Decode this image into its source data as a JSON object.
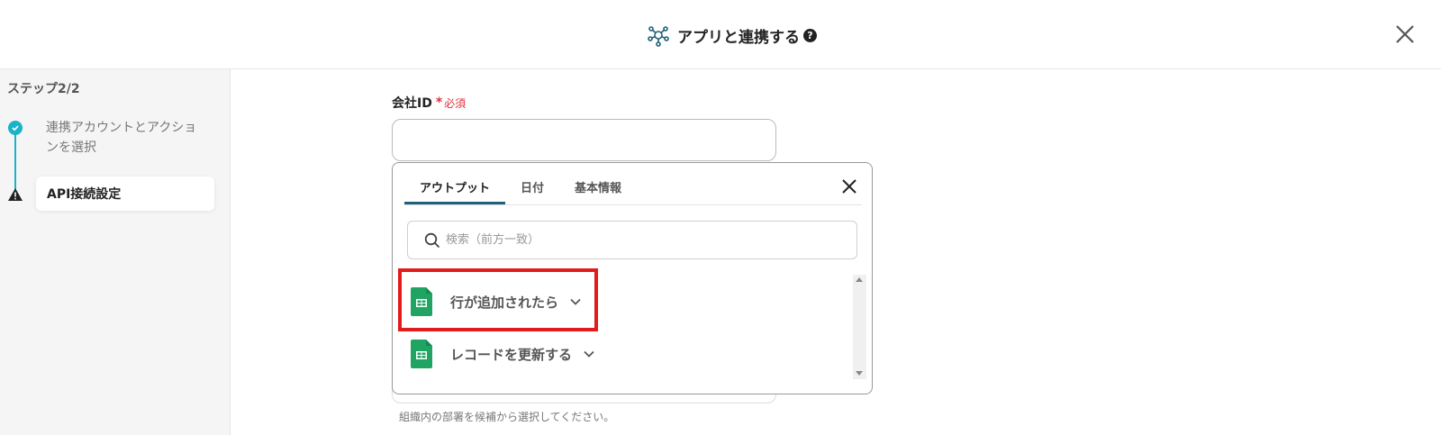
{
  "header": {
    "title": "アプリと連携する",
    "help_icon": "?",
    "icons": [
      "hub-icon",
      "help-icon",
      "close-icon"
    ]
  },
  "sidebar": {
    "heading": "ステップ2/2",
    "steps": [
      {
        "label": "連携アカウントとアクションを選択",
        "status": "completed",
        "icon": "check-icon"
      },
      {
        "label": "API接続設定",
        "status": "warning",
        "icon": "warning-icon"
      }
    ]
  },
  "form": {
    "field_label": "会社ID",
    "required_mark": "*",
    "required_text": "必須",
    "company_id_value": "",
    "helper_text": "組織内の部署を候補から選択してください。"
  },
  "dropdown": {
    "tabs": [
      {
        "label": "アウトプット",
        "active": true
      },
      {
        "label": "日付",
        "active": false
      },
      {
        "label": "基本情報",
        "active": false
      }
    ],
    "search_placeholder": "検索（前方一致）",
    "items": [
      {
        "label": "行が追加されたら",
        "icon": "google-sheets-icon",
        "highlighted": true
      },
      {
        "label": "レコードを更新する",
        "icon": "google-sheets-icon",
        "highlighted": false
      }
    ]
  },
  "colors": {
    "accent": "#1bb3c9",
    "required": "#e0313c",
    "highlight": "#e21c1c",
    "sheets_green": "#1fa463",
    "tab_underline": "#1f5f79"
  }
}
